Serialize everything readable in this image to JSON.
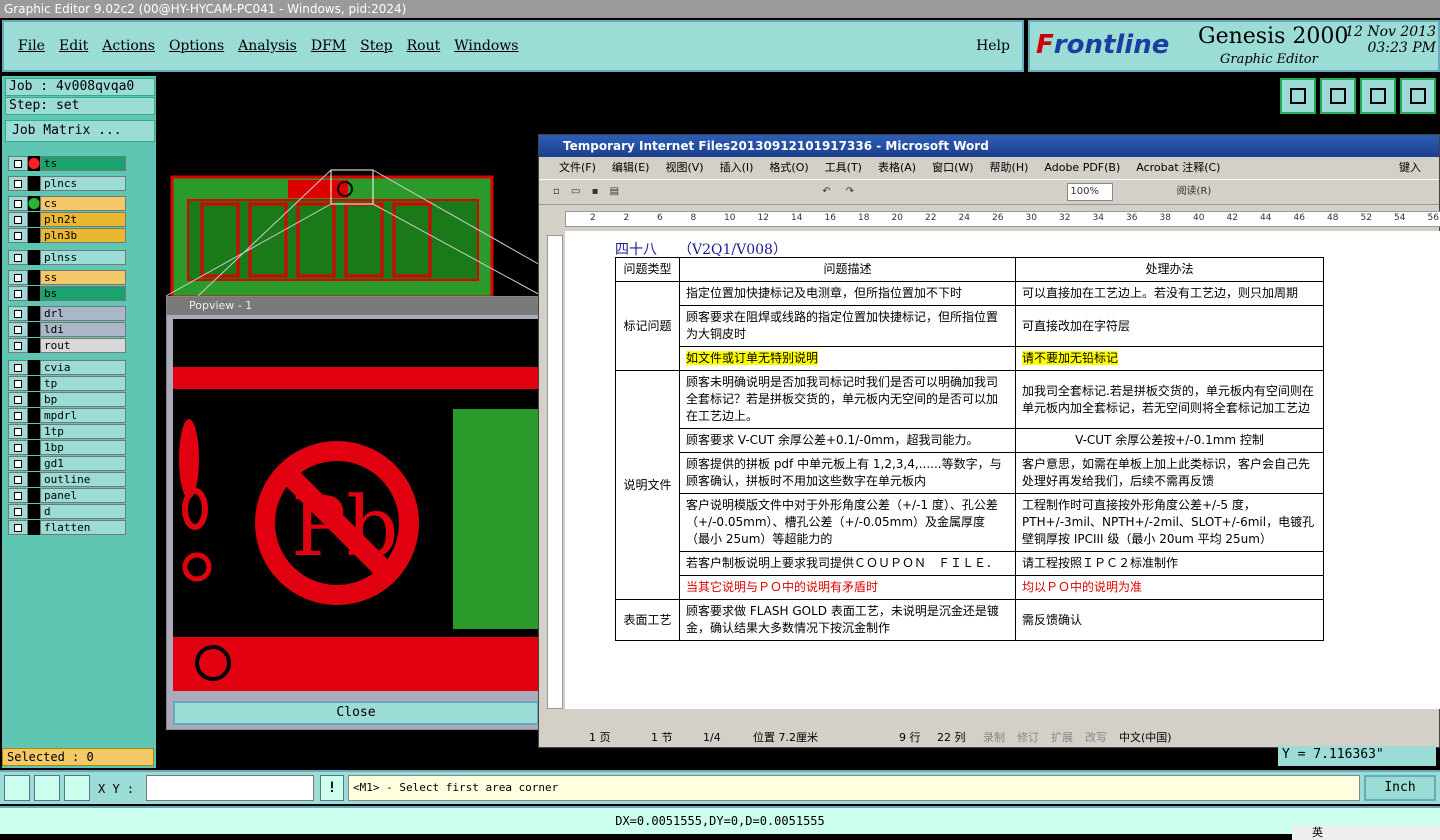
{
  "window": {
    "title": "Graphic Editor 9.02c2 (00@HY-HYCAM-PC041 - Windows, pid:2024)"
  },
  "menu": {
    "items": [
      "File",
      "Edit",
      "Actions",
      "Options",
      "Analysis",
      "DFM",
      "Step",
      "Rout",
      "Windows"
    ],
    "help": "Help"
  },
  "brand": {
    "logo_prefix": "F",
    "logo_rest": "rontline",
    "product": "Genesis 2000",
    "subtitle": "Graphic Editor",
    "date": "12 Nov 2013",
    "time": "03:23 PM"
  },
  "job": {
    "job": "Job : 4v008qvqa0",
    "step": "Step: set",
    "matrix": "Job Matrix ..."
  },
  "layers": [
    {
      "name": "ts",
      "color": "#1aa36f",
      "active": true,
      "dot": "#ff2020"
    },
    {
      "name": "plncs",
      "color": "#9cdcd6"
    },
    {
      "name": "cs",
      "color": "#f5c86a",
      "dot": "#2bb52b"
    },
    {
      "name": "pln2t",
      "color": "#e8b830"
    },
    {
      "name": "pln3b",
      "color": "#e8b830"
    },
    {
      "name": "plnss",
      "color": "#9cdcd6"
    },
    {
      "name": "ss",
      "color": "#f5c86a"
    },
    {
      "name": "bs",
      "color": "#1aa36f"
    },
    {
      "name": "drl",
      "color": "#a8b8c8"
    },
    {
      "name": "ldi",
      "color": "#a8b8c8"
    },
    {
      "name": "rout",
      "color": "#d8d8d8"
    },
    {
      "name": "cvia",
      "color": "#9cdcd6"
    },
    {
      "name": "tp",
      "color": "#9cdcd6"
    },
    {
      "name": "bp",
      "color": "#9cdcd6"
    },
    {
      "name": "mpdrl",
      "color": "#9cdcd6"
    },
    {
      "name": "1tp",
      "color": "#9cdcd6"
    },
    {
      "name": "1bp",
      "color": "#9cdcd6"
    },
    {
      "name": "gd1",
      "color": "#9cdcd6"
    },
    {
      "name": "outline",
      "color": "#9cdcd6"
    },
    {
      "name": "panel",
      "color": "#9cdcd6"
    },
    {
      "name": "d",
      "color": "#9cdcd6"
    },
    {
      "name": "flatten",
      "color": "#9cdcd6"
    }
  ],
  "popview": {
    "title": "Popview - 1",
    "close": "Close",
    "symbol": "Pb"
  },
  "word": {
    "title": "Temporary Internet Files20130912101917336 - Microsoft Word",
    "menu": [
      "文件(F)",
      "编辑(E)",
      "视图(V)",
      "插入(I)",
      "格式(O)",
      "工具(T)",
      "表格(A)",
      "窗口(W)",
      "帮助(H)",
      "Adobe PDF(B)",
      "Acrobat 注释(C)"
    ],
    "menu_right": "键入",
    "zoom": "100%",
    "read_label": "阅读(R)",
    "ruler": [
      "2",
      "2",
      "6",
      "8",
      "10",
      "12",
      "14",
      "16",
      "18",
      "20",
      "22",
      "24",
      "26",
      "30",
      "32",
      "34",
      "36",
      "38",
      "40",
      "42",
      "44",
      "46",
      "48",
      "52",
      "54",
      "56"
    ],
    "heading": "四十八　　（V2Q1/V008）",
    "table": {
      "headers": [
        "问题类型",
        "问题描述",
        "处理办法"
      ],
      "groups": [
        {
          "category": "标记问题",
          "rows": [
            {
              "desc": "指定位置加快捷标记及电测章，但所指位置加不下时",
              "fix": "可以直接加在工艺边上。若没有工艺边，则只加周期"
            },
            {
              "desc": "顾客要求在阻焊或线路的指定位置加快捷标记，但所指位置为大铜皮时",
              "fix": "可直接改加在字符层"
            },
            {
              "desc": "如文件或订单无特别说明",
              "fix": "请不要加无铅标记",
              "style": "hl"
            }
          ]
        },
        {
          "category": "说明文件",
          "rows": [
            {
              "desc": "顾客未明确说明是否加我司标记时我们是否可以明确加我司全套标记？若是拼板交货的，单元板内无空间的是否可以加在工艺边上。",
              "fix": "加我司全套标记.若是拼板交货的，单元板内有空间则在单元板内加全套标记，若无空间则将全套标记加工艺边"
            },
            {
              "desc": "顾客要求 V-CUT 余厚公差+0.1/-0mm，超我司能力。",
              "fix": "V-CUT 余厚公差按+/-0.1mm 控制",
              "center": true
            },
            {
              "desc": "顾客提供的拼板 pdf 中单元板上有 1,2,3,4,......等数字，与顾客确认，拼板时不用加这些数字在单元板内",
              "fix": "客户意思，如需在单板上加上此类标识，客户会自己先处理好再发给我们，后续不需再反馈"
            },
            {
              "desc": "客户说明模版文件中对于外形角度公差（+/-1 度）、孔公差（+/-0.05mm）、槽孔公差（+/-0.05mm）及金属厚度（最小 25um）等超能力的",
              "fix": "工程制作时可直接按外形角度公差+/-5 度，PTH+/-3mil、NPTH+/-2mil、SLOT+/-6mil，电镀孔壁铜厚按 IPCIII 级（最小 20um 平均 25um）"
            },
            {
              "desc": "若客户制板说明上要求我司提供ＣＯＵＰＯＮ　ＦＩＬＥ．",
              "fix": "请工程按照ＩＰＣ２标准制作"
            },
            {
              "desc": "当其它说明与ＰＯ中的说明有矛盾时",
              "fix": "均以ＰＯ中的说明为准",
              "style": "red"
            }
          ]
        },
        {
          "category": "表面工艺",
          "rows": [
            {
              "desc": "顾客要求做 FLASH GOLD 表面工艺，未说明是沉金还是镀金，确认结果大多数情况下按沉金制作",
              "fix": "需反馈确认"
            }
          ]
        }
      ]
    },
    "status": {
      "page": "1 页",
      "section": "1 节",
      "of": "1/4",
      "pos": "位置 7.2厘米",
      "line": "9 行",
      "col": "22 列",
      "rec": "录制",
      "trk": "修订",
      "ext": "扩展",
      "ovr": "改写",
      "lang": "中文(中国)"
    }
  },
  "selected": "Selected : 0",
  "y_coord": "Y = 7.116363\"",
  "cmd": {
    "xy_label": "X Y :",
    "xy_value": "",
    "prompt": "<M1> - Select first area corner",
    "unit": "Inch"
  },
  "bottom": "DX=0.0051555,DY=0,D=0.0051555",
  "tray": "英"
}
